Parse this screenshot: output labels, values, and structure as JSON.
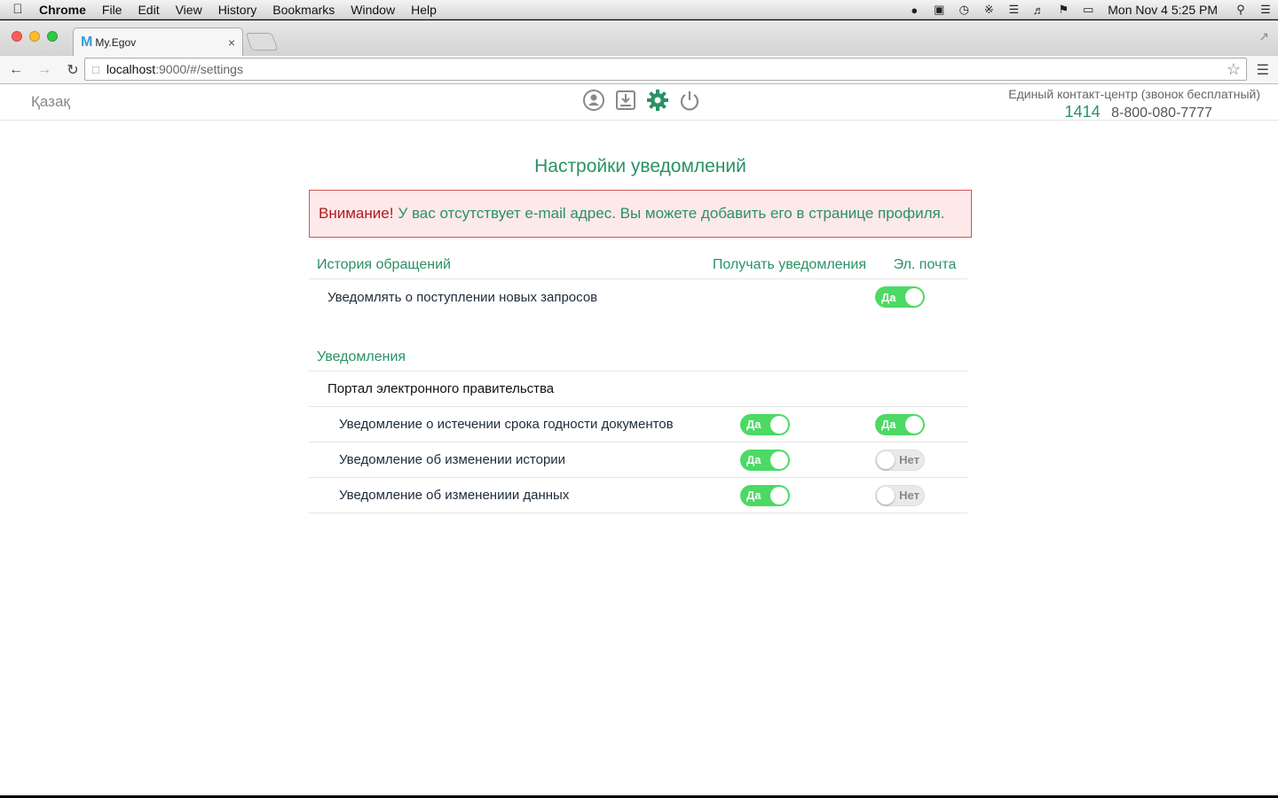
{
  "menubar": {
    "app": "Chrome",
    "items": [
      "File",
      "Edit",
      "View",
      "History",
      "Bookmarks",
      "Window",
      "Help"
    ],
    "clock": "Mon Nov 4  5:25 PM"
  },
  "browser": {
    "tab_title": "My.Egov",
    "url_host": "localhost",
    "url_path": ":9000/#/settings"
  },
  "header": {
    "language": "Қазақ",
    "contact_label": "Единый контакт-центр (звонок бесплатный)",
    "phone_short": "1414",
    "phone_long": "8-800-080-7777"
  },
  "main": {
    "title": "Настройки уведомлений",
    "alert_strong": "Внимание!",
    "alert_text": "У вас отсутствует e-mail адрес. Вы можете добавить его в странице профиля.",
    "history_section": "История обращений",
    "col_receive": "Получать уведомления",
    "col_email": "Эл. почта",
    "history_row": {
      "label": "Уведомлять о поступлении новых запросов",
      "email": "Да"
    },
    "notifications_section": "Уведомления",
    "group_label": "Портал электронного правительства",
    "rows": [
      {
        "label": "Уведомление о истечении срока годности документов",
        "receive": "Да",
        "email": "Да"
      },
      {
        "label": "Уведомление об изменении истории",
        "receive": "Да",
        "email": "Нет"
      },
      {
        "label": "Уведомление об изменениии данных",
        "receive": "Да",
        "email": "Нет"
      }
    ]
  },
  "colors": {
    "accent": "#2a9166",
    "toggle_on": "#4cd964",
    "alert_border": "#d9534f"
  }
}
